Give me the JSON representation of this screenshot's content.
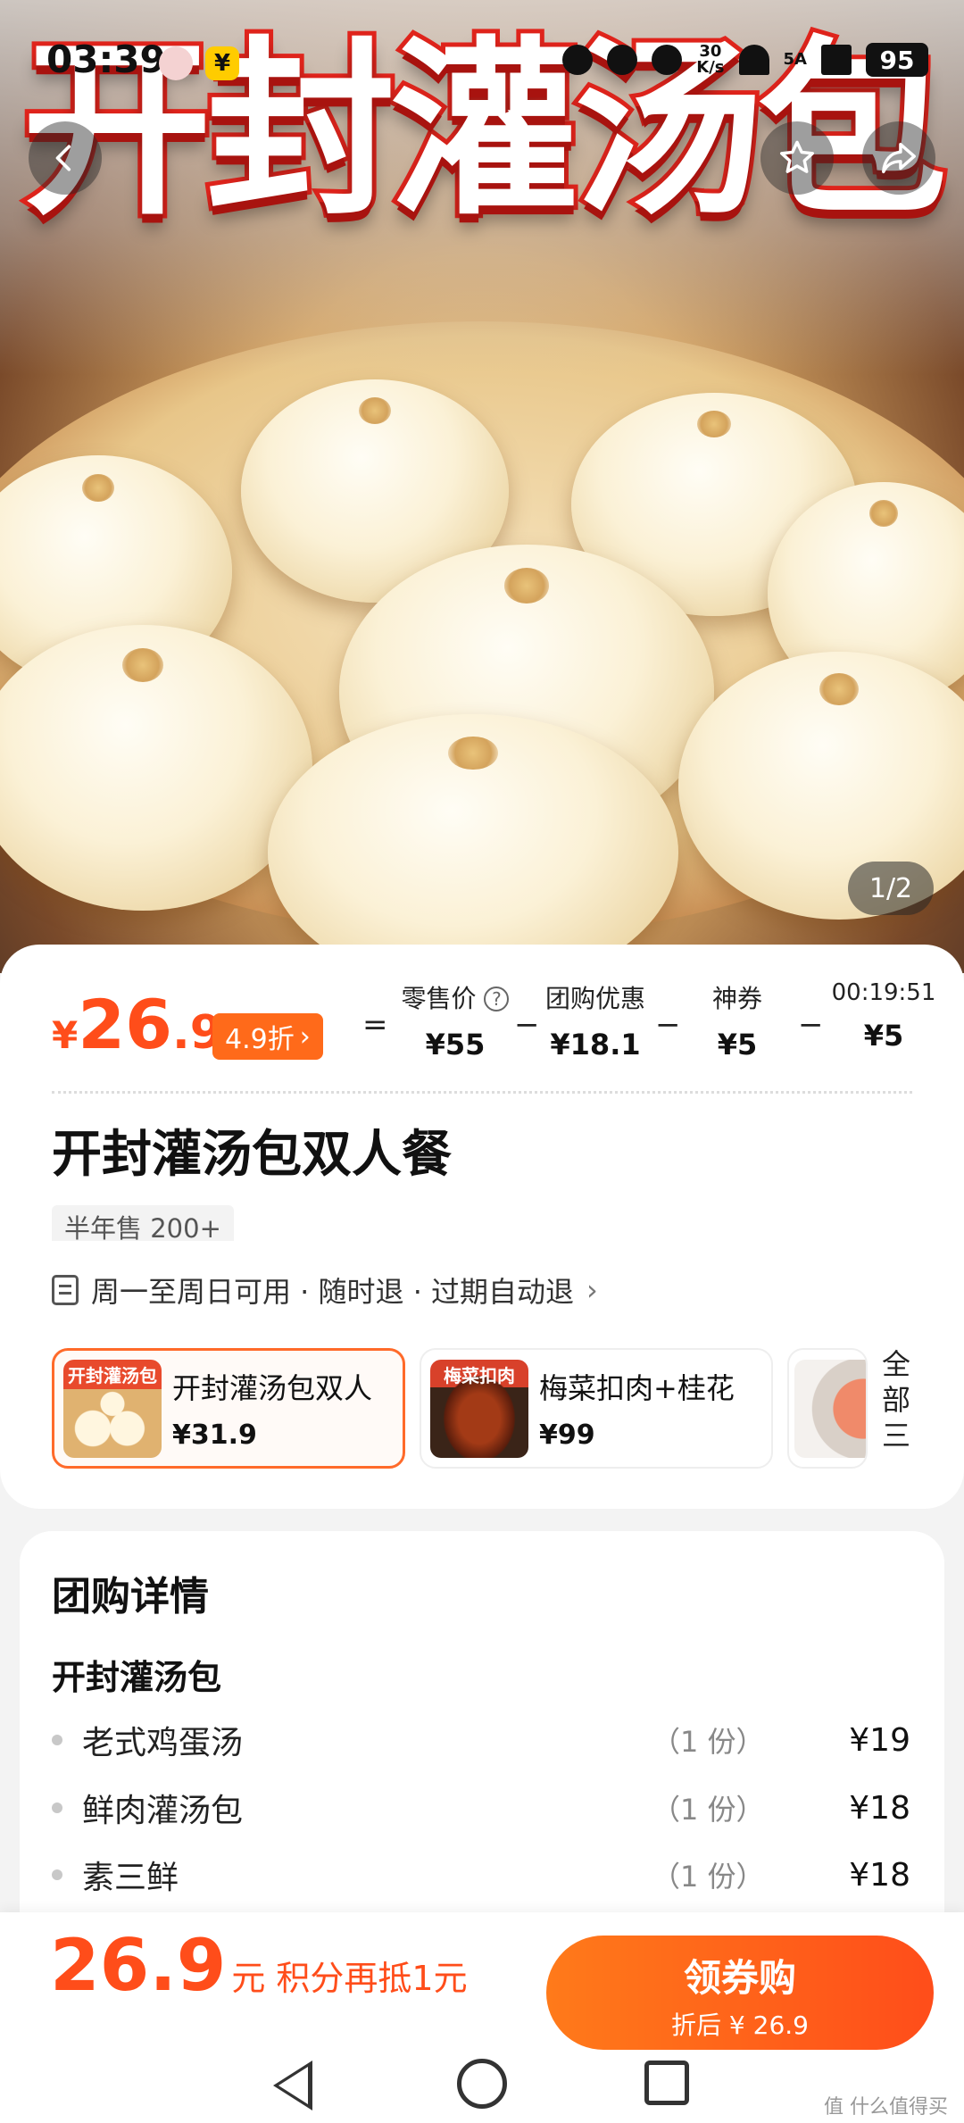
{
  "status_bar": {
    "time": "03:39",
    "yen_badge": "¥",
    "net_speed_top": "30",
    "net_speed_bottom": "K/s",
    "sim_label": "5A",
    "battery": "95"
  },
  "hero": {
    "title_text": "开封灌汤包",
    "pager": "1/2"
  },
  "price": {
    "yen": "¥",
    "integer": "26",
    "decimal": ".9",
    "discount": "4.9折",
    "discount_chevron": "›",
    "equals": "=",
    "minus": "−",
    "breakdown": [
      {
        "label": "零售价",
        "value": "¥55"
      },
      {
        "label": "团购优惠",
        "value": "¥18.1"
      },
      {
        "label": "神券",
        "value": "¥5"
      },
      {
        "label": "00:19:51",
        "value": "¥5"
      }
    ],
    "help_icon": "?"
  },
  "product": {
    "title": "开封灌汤包双人餐",
    "sold": "半年售 200+",
    "policy": "周一至周日可用 · 随时退 · 过期自动退",
    "policy_chevron": "›"
  },
  "packages": [
    {
      "caption": "开封灌汤包",
      "name": "开封灌汤包双人",
      "price": "¥31.9"
    },
    {
      "caption": "梅菜扣肉",
      "name": "梅菜扣肉+桂花",
      "price": "¥99"
    }
  ],
  "all_link": "全部三",
  "detail": {
    "title": "团购详情",
    "section": "开封灌汤包",
    "items": [
      {
        "name": "老式鸡蛋汤",
        "qty": "（1 份）",
        "price": "¥19"
      },
      {
        "name": "鲜肉灌汤包",
        "qty": "（1 份）",
        "price": "¥18"
      },
      {
        "name": "素三鲜",
        "qty": "（1 份）",
        "price": "¥18"
      }
    ]
  },
  "bottom_bar": {
    "price": "26.9",
    "unit": "元",
    "points": "积分再抵1元",
    "buy_label": "领券购",
    "buy_sub": "折后 ¥ 26.9"
  },
  "watermark": "值 什么值得买",
  "colors": {
    "accent": "#ff4d1a",
    "brand_orange": "#ff6a1a"
  },
  "icons": [
    "back-arrow-icon",
    "star-icon",
    "share-icon",
    "document-icon",
    "help-icon"
  ]
}
